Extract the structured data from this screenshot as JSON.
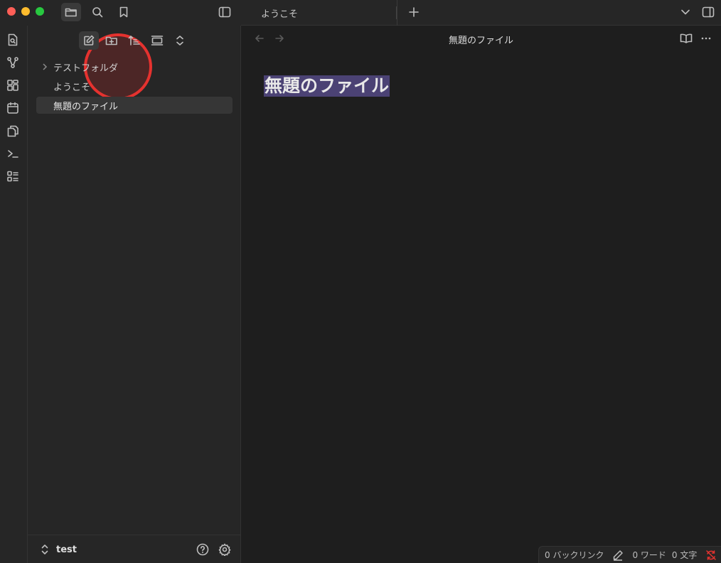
{
  "app": {
    "colors": {
      "background": "#1e1e1e",
      "sidebar": "#262626",
      "selection": "#4b4274",
      "highlight": "#e5322f"
    }
  },
  "tabs": [
    {
      "label": "ようこそ"
    }
  ],
  "icons": {
    "titlebar": [
      "folder-icon",
      "search-icon",
      "bookmark-icon",
      "sidebar-toggle-icon",
      "plus-icon",
      "chevron-down-icon",
      "right-sidebar-icon"
    ],
    "ribbon": [
      "quick-switcher-icon",
      "graph-icon",
      "canvas-icon",
      "calendar-icon",
      "templates-icon",
      "terminal-icon",
      "command-palette-icon"
    ],
    "file_toolbar": [
      "new-note-icon",
      "new-folder-icon",
      "sort-icon",
      "collapse-view-icon",
      "expand-collapse-icon"
    ]
  },
  "file_tree": [
    {
      "label": "テストフォルダ",
      "type": "folder"
    },
    {
      "label": "ようこそ",
      "type": "file"
    },
    {
      "label": "無題のファイル",
      "type": "file",
      "selected": true
    }
  ],
  "vault": {
    "name": "test"
  },
  "editor": {
    "view_title": "無題のファイル",
    "doc_title": "無題のファイル"
  },
  "status": {
    "backlinks": "0 バックリンク",
    "words": "0 ワード",
    "chars": "0 文字"
  }
}
